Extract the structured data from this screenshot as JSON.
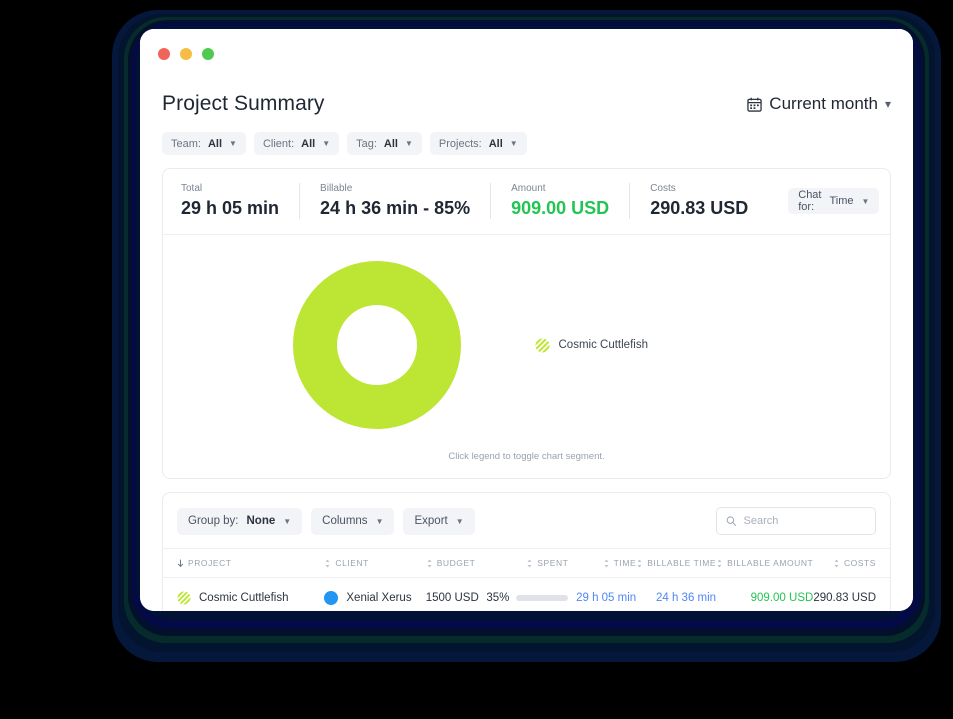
{
  "window": {
    "traffic_lights": [
      "close",
      "minimize",
      "maximize"
    ]
  },
  "header": {
    "title": "Project Summary",
    "date_range": "Current month",
    "calendar_icon": "calendar-icon",
    "chevron_icon": "chevron-down-icon"
  },
  "filters": [
    {
      "label": "Team:",
      "value": "All"
    },
    {
      "label": "Client:",
      "value": "All"
    },
    {
      "label": "Tag:",
      "value": "All"
    },
    {
      "label": "Projects:",
      "value": "All"
    }
  ],
  "stats": [
    {
      "label": "Total",
      "value": "29 h 05 min",
      "color": "#1f2733"
    },
    {
      "label": "Billable",
      "value": "24 h 36 min - 85%",
      "color": "#1f2733"
    },
    {
      "label": "Amount",
      "value": "909.00 USD",
      "color": "#23c552"
    },
    {
      "label": "Costs",
      "value": "290.83 USD",
      "color": "#1f2733"
    }
  ],
  "chat_for": {
    "label": "Chat for:",
    "value": "Time"
  },
  "chart_data": {
    "type": "pie",
    "title": "",
    "categories": [
      "Cosmic Cuttlefish"
    ],
    "values": [
      100
    ],
    "value_unit": "percent",
    "colors": [
      "#bde534"
    ],
    "legend_position": "right",
    "legend": [
      {
        "name": "Cosmic Cuttlefish",
        "color": "#bde534",
        "pattern": "diagonal-stripes"
      }
    ],
    "donut": true,
    "note": "Click legend to toggle chart segment."
  },
  "table_toolbar": {
    "group_by": {
      "label": "Group by:",
      "value": "None"
    },
    "columns_label": "Columns",
    "export_label": "Export",
    "search": {
      "placeholder": "Search",
      "value": ""
    },
    "search_icon": "search-icon"
  },
  "table": {
    "columns": [
      {
        "key": "project",
        "label": "PROJECT",
        "align": "left",
        "sorted": true
      },
      {
        "key": "client",
        "label": "CLIENT",
        "align": "left",
        "sorted": false
      },
      {
        "key": "budget",
        "label": "BUDGET",
        "align": "left",
        "sorted": false
      },
      {
        "key": "spent",
        "label": "SPENT",
        "align": "right",
        "sorted": false
      },
      {
        "key": "time",
        "label": "TIME",
        "align": "right",
        "sorted": false
      },
      {
        "key": "billable_time",
        "label": "BILLABLE TIME",
        "align": "right",
        "sorted": false
      },
      {
        "key": "billable_amount",
        "label": "BILLABLE AMOUNT",
        "align": "right",
        "sorted": false
      },
      {
        "key": "costs",
        "label": "COSTS",
        "align": "right",
        "sorted": false
      }
    ],
    "rows": [
      {
        "project": "Cosmic Cuttlefish",
        "project_color": "#bde534",
        "client": "Xenial Xerus",
        "client_color": "#2196f3",
        "budget": "1500 USD",
        "spent_percent": "35%",
        "spent_value": 35,
        "time": "29 h 05 min",
        "billable_time": "24 h 36 min",
        "billable_amount": "909.00 USD",
        "costs": "290.83 USD"
      }
    ]
  }
}
